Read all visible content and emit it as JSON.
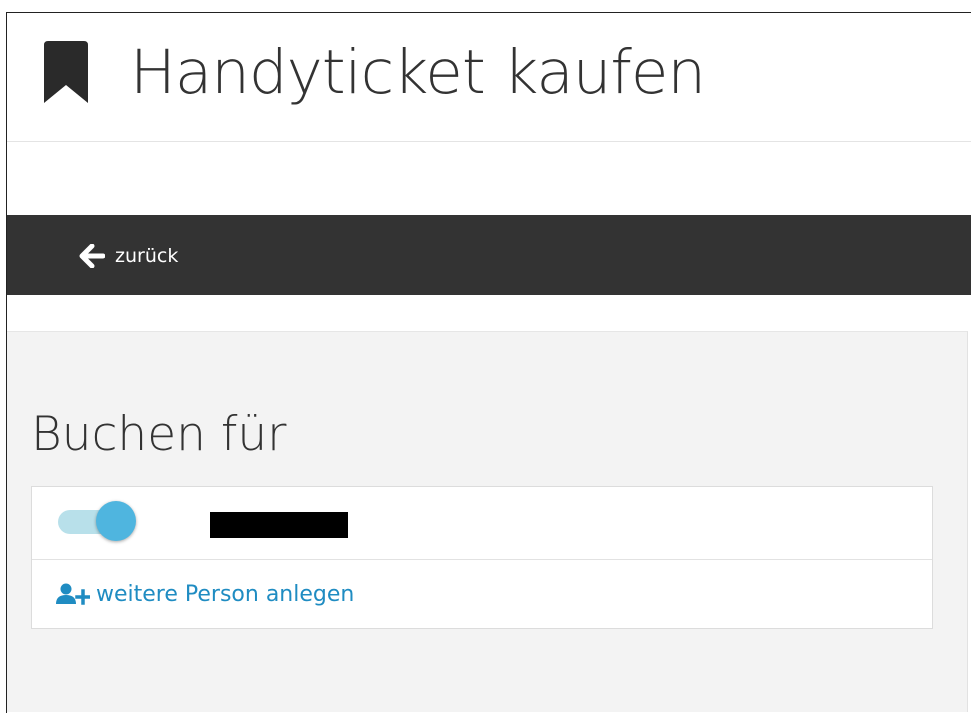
{
  "header": {
    "title": "Handyticket kaufen",
    "icon": "bookmark-icon"
  },
  "navbar": {
    "back_label": "zurück",
    "back_icon": "arrow-left-icon"
  },
  "booking": {
    "section_title": "Buchen für",
    "person": {
      "toggle_on": true,
      "name_redacted": true
    },
    "add_person_label": "weitere Person anlegen",
    "add_person_icon": "user-plus-icon"
  },
  "colors": {
    "navbar_bg": "#333333",
    "accent": "#1f8cc2",
    "toggle_knob": "#4fb5df",
    "toggle_track": "#b8e0ea",
    "content_bg": "#f3f3f3"
  }
}
